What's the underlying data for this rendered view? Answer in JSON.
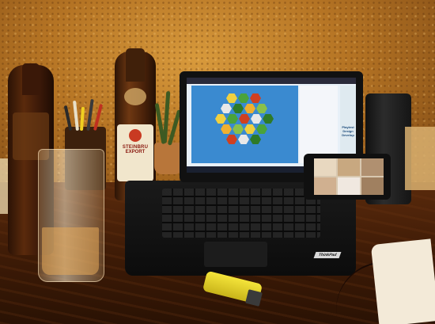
{
  "scene": {
    "description_tags": [
      "desk",
      "laptop",
      "beer-bottles",
      "glass",
      "phone-video-call",
      "lighter"
    ],
    "bottle_label": {
      "line1": "STEINBRU",
      "line2": "EXPORT"
    },
    "promo_text": {
      "line1": "Playtest",
      "line2": "Design",
      "line3": "Develop"
    },
    "laptop_logo": "ThinkPad",
    "colors": {
      "wall": "#c8862e",
      "desk": "#4a200a",
      "lighter": "#f1e02e",
      "board_water": "#3a8ad0"
    },
    "board_hex_colors": [
      "#f0d040",
      "#4aa33a",
      "#d04020",
      "#e8e8e8",
      "#2e7a28",
      "#f0b030",
      "#8ac04a"
    ]
  }
}
